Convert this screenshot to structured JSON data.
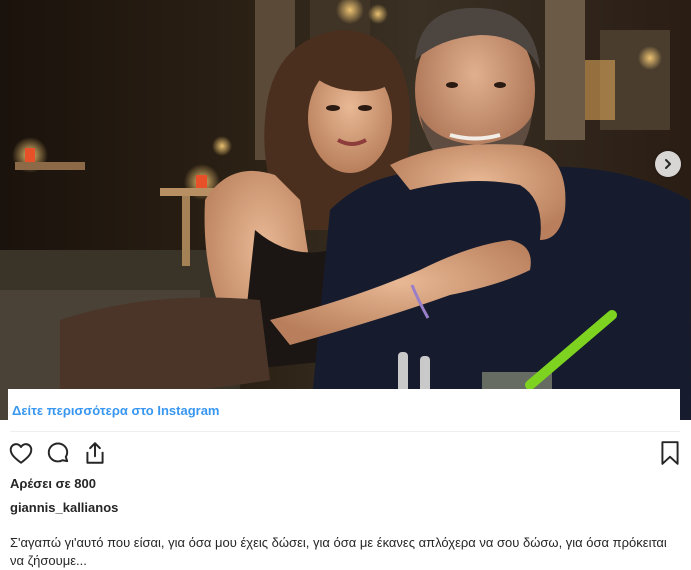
{
  "post": {
    "photo_alt": "",
    "view_more_label": "Δείτε περισσότερα στο Instagram",
    "likes_text": "Αρέσει σε 800",
    "username": "giannis_kallianos",
    "caption": "Σ'αγαπώ γι'αυτό που είσαι, για όσα μου έχεις δώσει, για όσα με έκανες απλόχερα να σου δώσω, για όσα πρόκειται να ζήσουμε..."
  },
  "icons": {
    "like": "heart-icon",
    "comment": "comment-icon",
    "share": "share-icon",
    "save": "bookmark-icon",
    "next": "chevron-right-icon"
  },
  "colors": {
    "link": "#3897f0",
    "text": "#262626",
    "divider": "#efefef"
  }
}
